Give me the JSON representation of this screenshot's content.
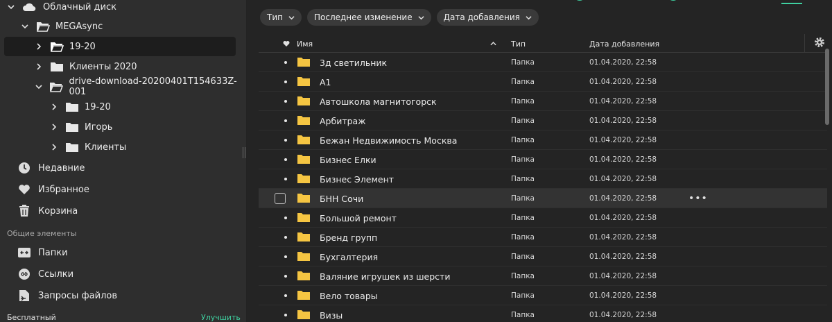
{
  "sidebar": {
    "cloud_drive": "Облачный диск",
    "tree": [
      {
        "label": "MEGAsync",
        "expanded": true
      },
      {
        "label": "19-20",
        "expanded": false,
        "selected": true
      },
      {
        "label": "Клиенты 2020",
        "expanded": false
      },
      {
        "label": "drive-download-20200401T154633Z-001",
        "expanded": true
      },
      {
        "label": "19-20",
        "expanded": false
      },
      {
        "label": "Игорь",
        "expanded": false
      },
      {
        "label": "Клиенты",
        "expanded": false
      }
    ],
    "nav": [
      {
        "label": "Недавние",
        "icon": "clock-icon"
      },
      {
        "label": "Избранное",
        "icon": "heart-icon"
      },
      {
        "label": "Корзина",
        "icon": "trash-icon"
      }
    ],
    "shared_section_label": "Общие элементы",
    "shared": [
      {
        "label": "Папки",
        "icon": "shared-folders-icon"
      },
      {
        "label": "Ссылки",
        "icon": "link-icon"
      },
      {
        "label": "Запросы файлов",
        "icon": "file-request-icon"
      }
    ],
    "plan_label": "Бесплатный",
    "upgrade_label": "Улучшить"
  },
  "filters": [
    {
      "label": "Тип"
    },
    {
      "label": "Последнее изменение"
    },
    {
      "label": "Дата добавления"
    }
  ],
  "table": {
    "columns": {
      "name": "Имя",
      "type": "Тип",
      "date_added": "Дата добавления"
    },
    "rows": [
      {
        "name": "3д светильник",
        "type": "Папка",
        "date": "01.04.2020, 22:58"
      },
      {
        "name": "A1",
        "type": "Папка",
        "date": "01.04.2020, 22:58"
      },
      {
        "name": "Автошкола магнитогорск",
        "type": "Папка",
        "date": "01.04.2020, 22:58"
      },
      {
        "name": "Арбитраж",
        "type": "Папка",
        "date": "01.04.2020, 22:58"
      },
      {
        "name": "Бежан Недвижимость Москва",
        "type": "Папка",
        "date": "01.04.2020, 22:58"
      },
      {
        "name": "Бизнес Елки",
        "type": "Папка",
        "date": "01.04.2020, 22:58"
      },
      {
        "name": "Бизнес Элемент",
        "type": "Папка",
        "date": "01.04.2020, 22:58"
      },
      {
        "name": "БНН Сочи",
        "type": "Папка",
        "date": "01.04.2020, 22:58",
        "hover": true
      },
      {
        "name": "Большой ремонт",
        "type": "Папка",
        "date": "01.04.2020, 22:58"
      },
      {
        "name": "Бренд групп",
        "type": "Папка",
        "date": "01.04.2020, 22:58"
      },
      {
        "name": "Бухгалтерия",
        "type": "Папка",
        "date": "01.04.2020, 22:58"
      },
      {
        "name": "Валяние игрушек из шерсти",
        "type": "Папка",
        "date": "01.04.2020, 22:58"
      },
      {
        "name": "Вело товары",
        "type": "Папка",
        "date": "01.04.2020, 22:58"
      },
      {
        "name": "Визы",
        "type": "Папка",
        "date": "01.04.2020, 22:58"
      }
    ]
  },
  "colors": {
    "folder": "#f5c542",
    "accent": "#3fd0a0",
    "sidebar_bg": "#2e2e2e",
    "main_bg": "#242424"
  }
}
